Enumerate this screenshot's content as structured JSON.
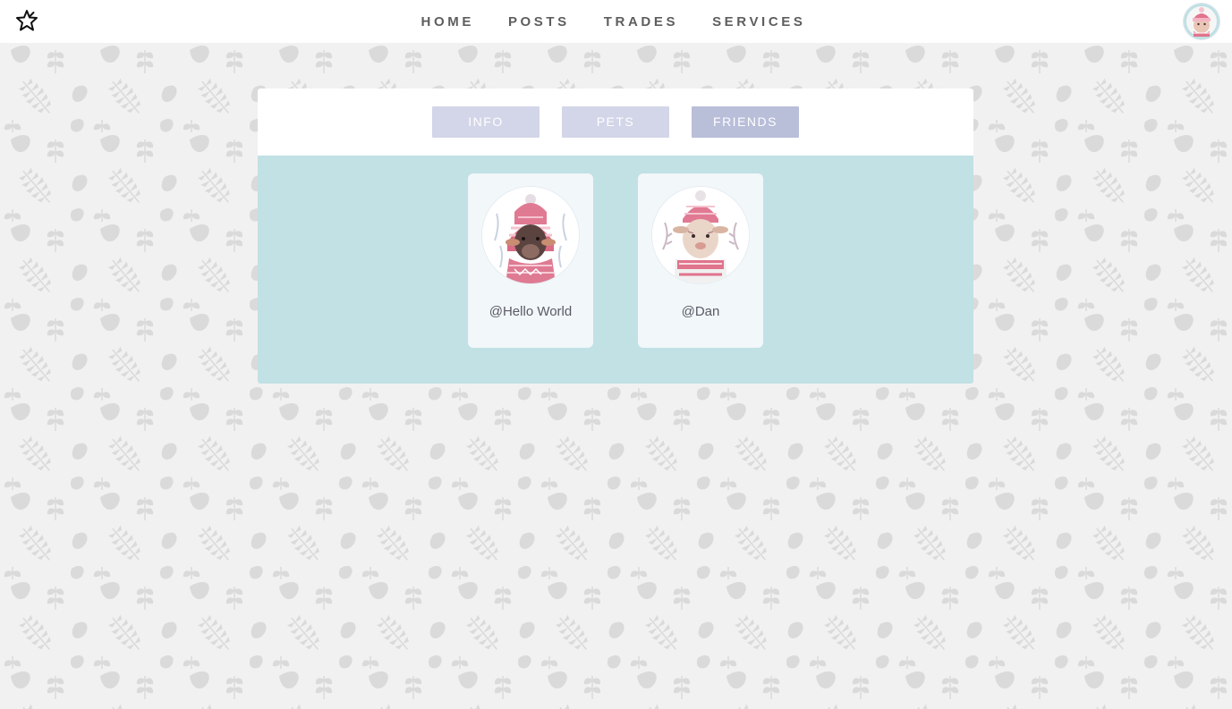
{
  "nav": {
    "logo_icon": "star-outline-icon",
    "links": [
      "HOME",
      "POSTS",
      "TRADES",
      "SERVICES"
    ],
    "avatar_icon": "user-avatar-animal-icon"
  },
  "profile_tabs": [
    {
      "label": "INFO",
      "active": false
    },
    {
      "label": "PETS",
      "active": false
    },
    {
      "label": "FRIENDS",
      "active": true
    }
  ],
  "friends": [
    {
      "name": "@Hello World",
      "avatar_icon": "dark-lamb-in-pink-hat-icon"
    },
    {
      "name": "@Dan",
      "avatar_icon": "light-lamb-in-pink-hat-icon"
    }
  ],
  "colors": {
    "page_background": "#f1f1f1",
    "navbar": "#ffffff",
    "tab_inactive": "#d3d5e8",
    "tab_active": "#b9bed9",
    "panel_body": "#c1e1e5",
    "card": "#f2f7fa",
    "nav_text": "#5e5e5e",
    "accent_pink": "#e0748c"
  }
}
